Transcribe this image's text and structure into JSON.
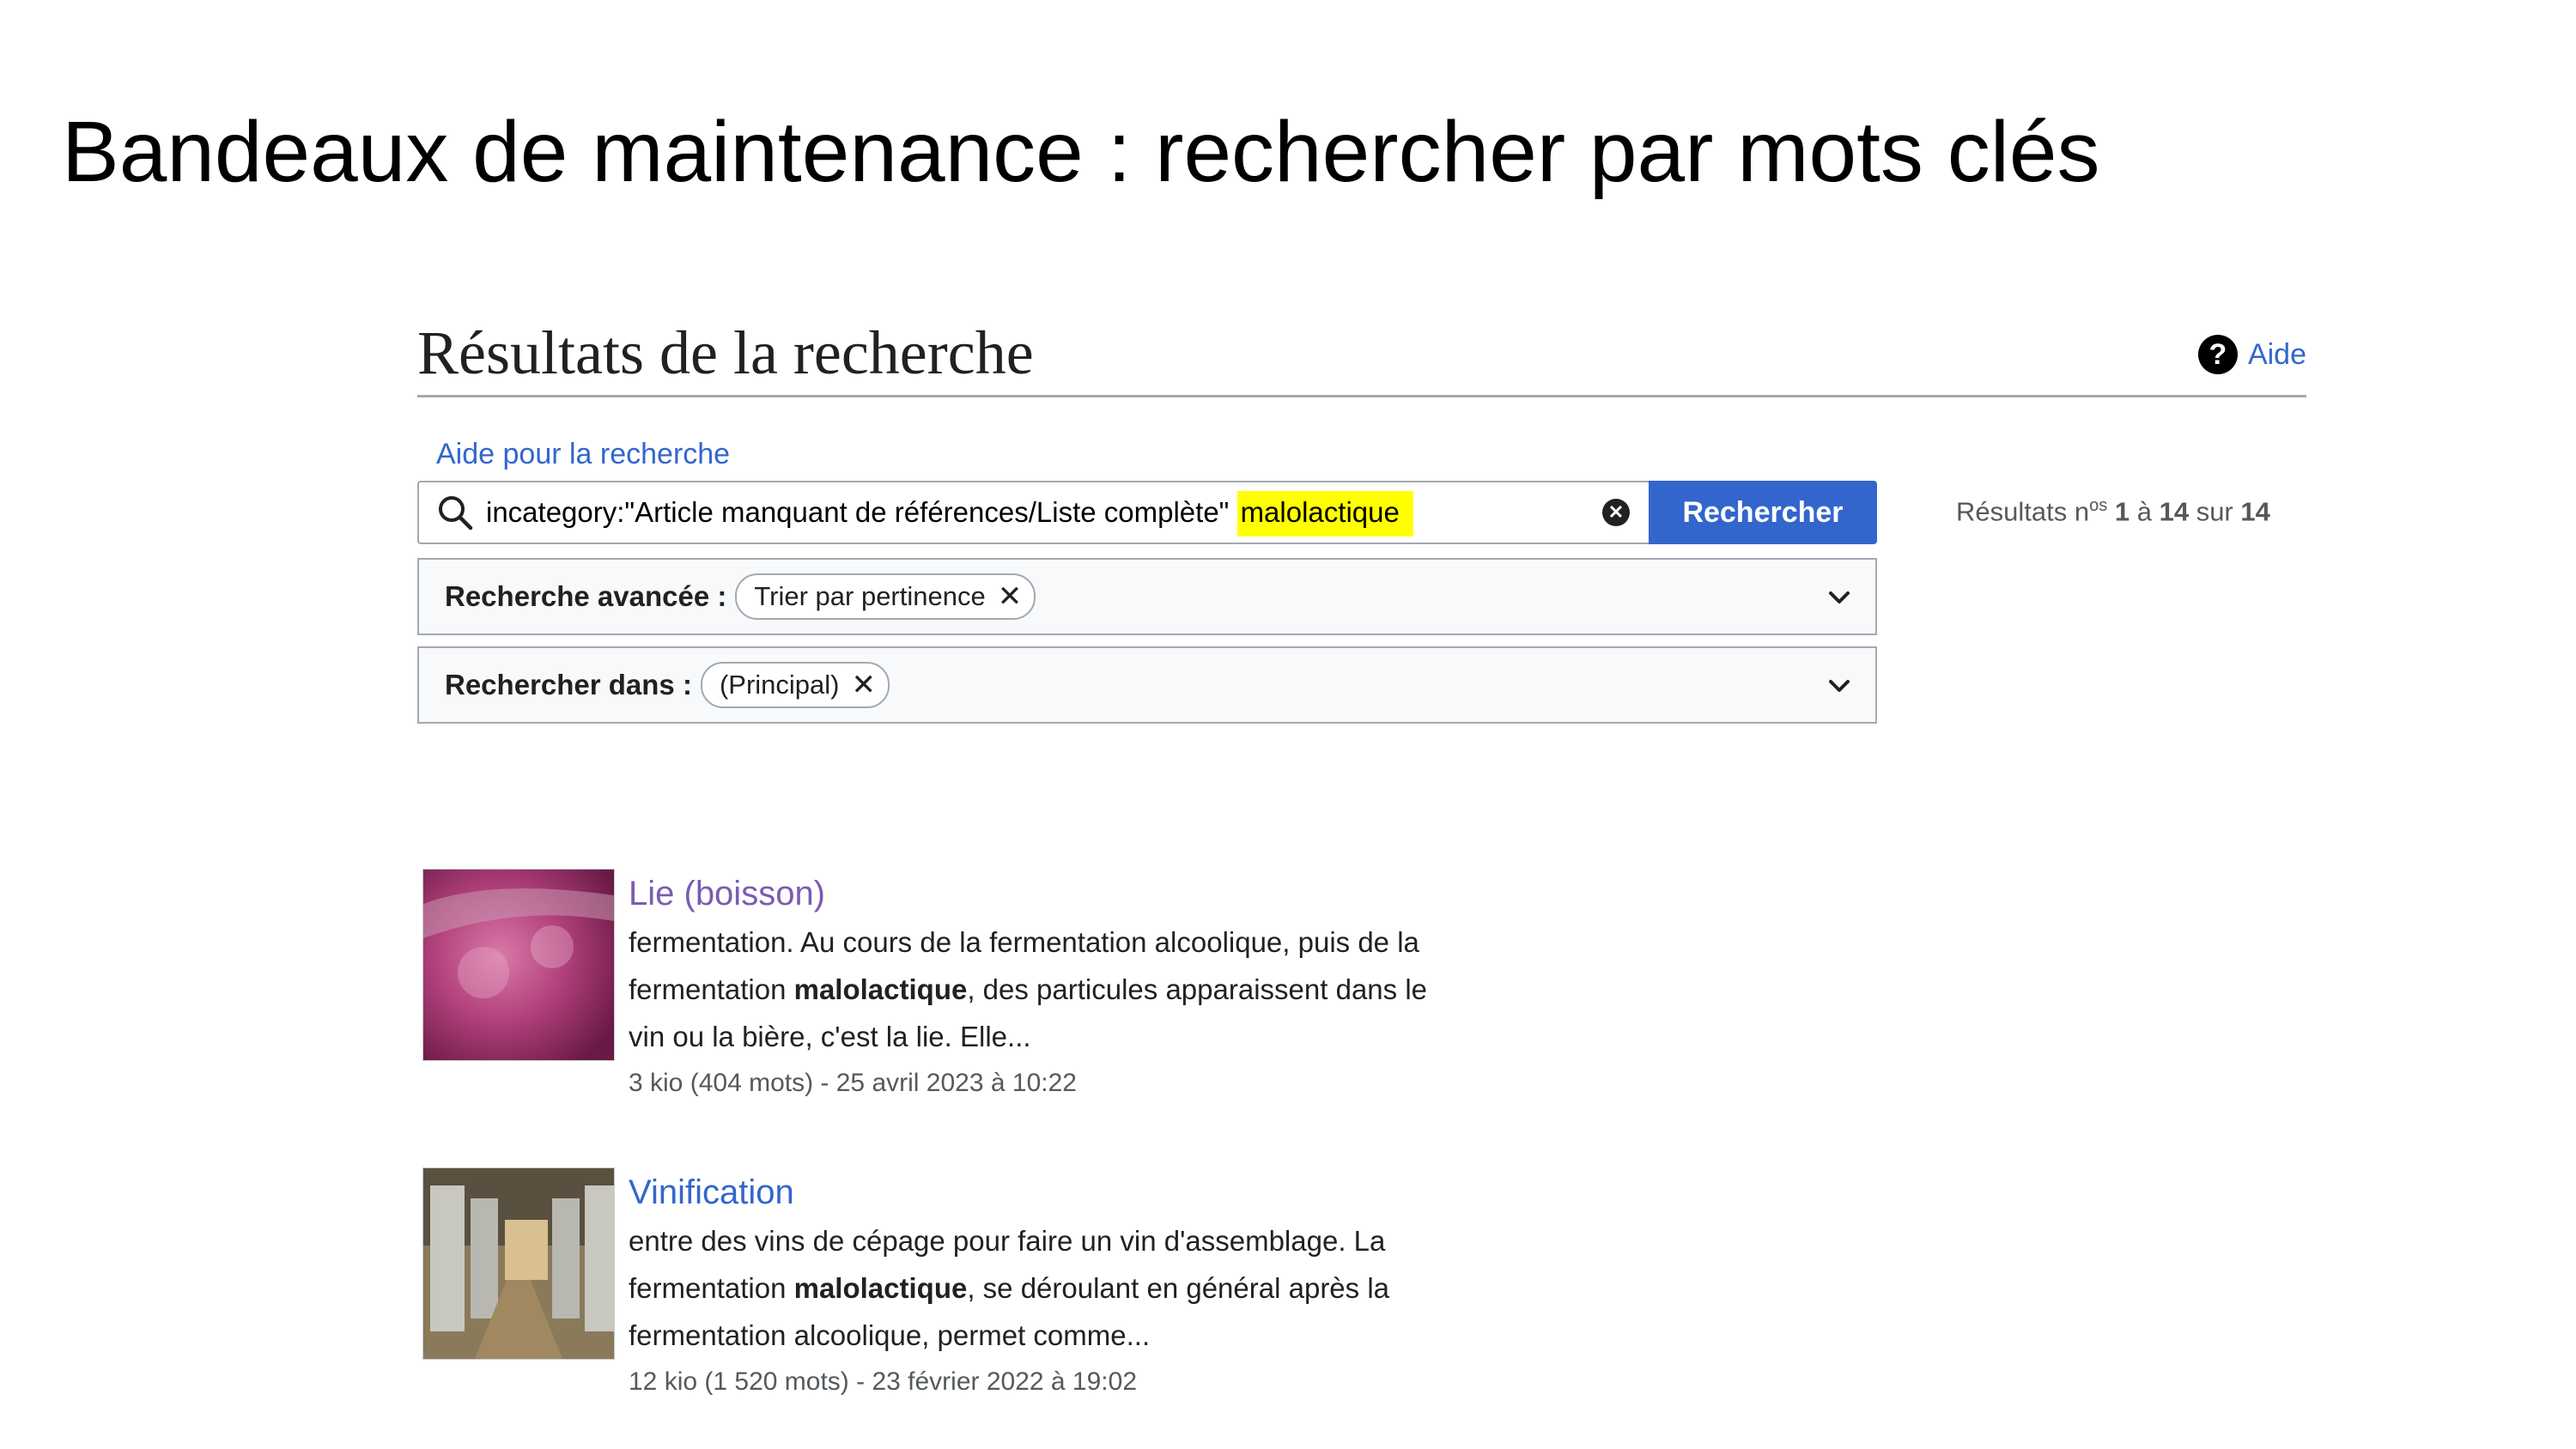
{
  "slide": {
    "title": "Bandeaux de maintenance : rechercher par mots clés"
  },
  "page": {
    "heading": "Résultats de la recherche",
    "help_label": "Aide",
    "search_help_link": "Aide pour la recherche"
  },
  "search": {
    "query_prefix": "incategory:\"Article manquant de références/Liste complète\"",
    "query_highlight": "malolactique",
    "button_label": "Rechercher"
  },
  "results_summary": {
    "prefix": "Résultats n",
    "sup": "os",
    "from": "1",
    "sep1": "à",
    "to": "14",
    "sep2": "sur",
    "total": "14"
  },
  "advanced": {
    "label": "Recherche avancée :",
    "chip": "Trier par pertinence"
  },
  "namespace": {
    "label": "Rechercher dans :",
    "chip": "(Principal)"
  },
  "results": [
    {
      "title": "Lie (boisson)",
      "line1": "fermentation. Au cours de la fermentation alcoolique, puis de la",
      "line2_pre": "fermentation ",
      "line2_bold": "malolactique",
      "line2_post": ", des particules apparaissent dans le",
      "line3": "vin ou la bière, c'est la lie. Elle...",
      "meta": "3 kio (404 mots) - 25 avril 2023 à 10:22"
    },
    {
      "title": "Vinification",
      "line1": "entre des vins de cépage pour faire un vin d'assemblage. La",
      "line2_pre": "fermentation ",
      "line2_bold": "malolactique",
      "line2_post": ", se déroulant en général après la",
      "line3": "fermentation alcoolique, permet comme...",
      "meta": "12 kio (1 520 mots) - 23 février 2022 à 19:02"
    }
  ],
  "colors": {
    "link": "#3366cc",
    "visited": "#795cb2",
    "highlight": "#ffff00",
    "button": "#3366cc"
  }
}
